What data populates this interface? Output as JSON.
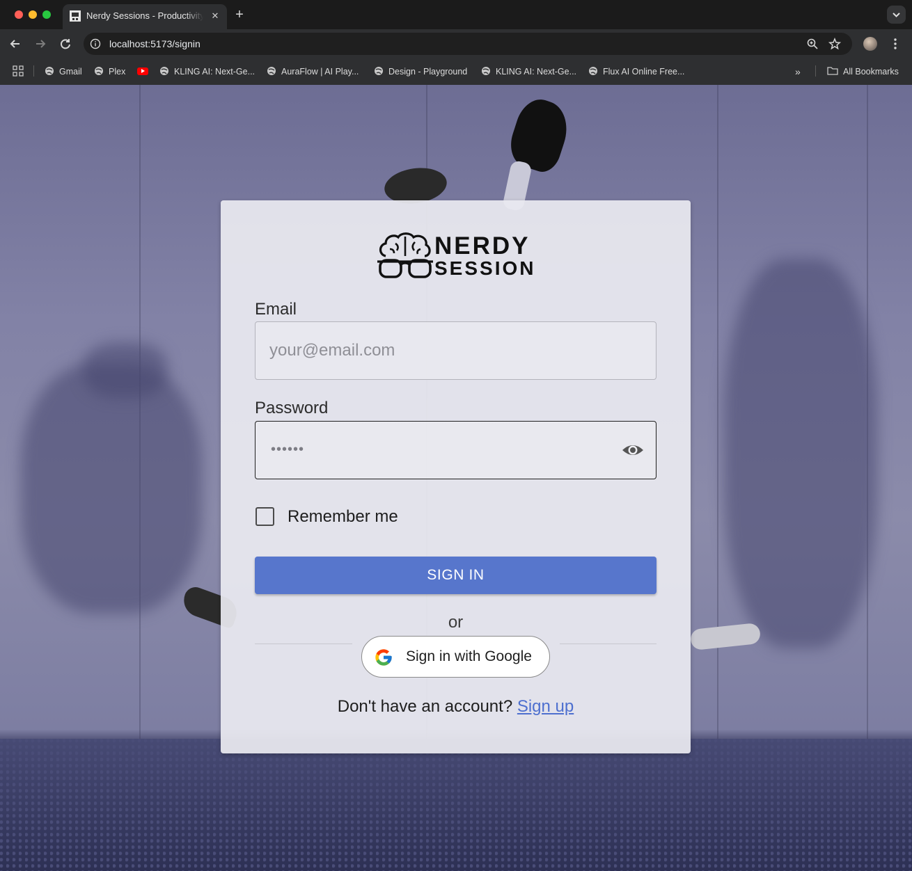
{
  "browser": {
    "tab_title": "Nerdy Sessions - Productivity",
    "tab_close": "✕",
    "new_tab": "+",
    "url": "localhost:5173/signin",
    "bookmarks": [
      {
        "label": "Gmail"
      },
      {
        "label": "Plex"
      },
      {
        "label": ""
      },
      {
        "label": "KLING AI: Next-Ge..."
      },
      {
        "label": "AuraFlow | AI Play..."
      },
      {
        "label": "Design - Playground"
      },
      {
        "label": "KLING AI: Next-Ge..."
      },
      {
        "label": "Flux AI Online Free..."
      }
    ],
    "bookmarks_more": "»",
    "all_bookmarks": "All Bookmarks",
    "icons": [
      "back-icon",
      "forward-icon",
      "reload-icon",
      "site-info-icon",
      "zoom-icon",
      "star-icon",
      "profile-avatar",
      "menu-icon",
      "apps-icon",
      "folder-icon",
      "youtube-icon"
    ]
  },
  "signin": {
    "brand_line1": "NERDY",
    "brand_line2": "SESSION",
    "email_label": "Email",
    "email_placeholder": "your@email.com",
    "email_value": "",
    "password_label": "Password",
    "password_value": "••••••",
    "remember_label": "Remember me",
    "remember_checked": false,
    "signin_button": "SIGN IN",
    "or_text": "or",
    "google_button": "Sign in with Google",
    "no_account_text": "Don't have an account?",
    "signup_link": "Sign up"
  },
  "colors": {
    "primary_button": "#5776cc",
    "link": "#4d6fcf",
    "card_bg": "#e9e9f0"
  }
}
